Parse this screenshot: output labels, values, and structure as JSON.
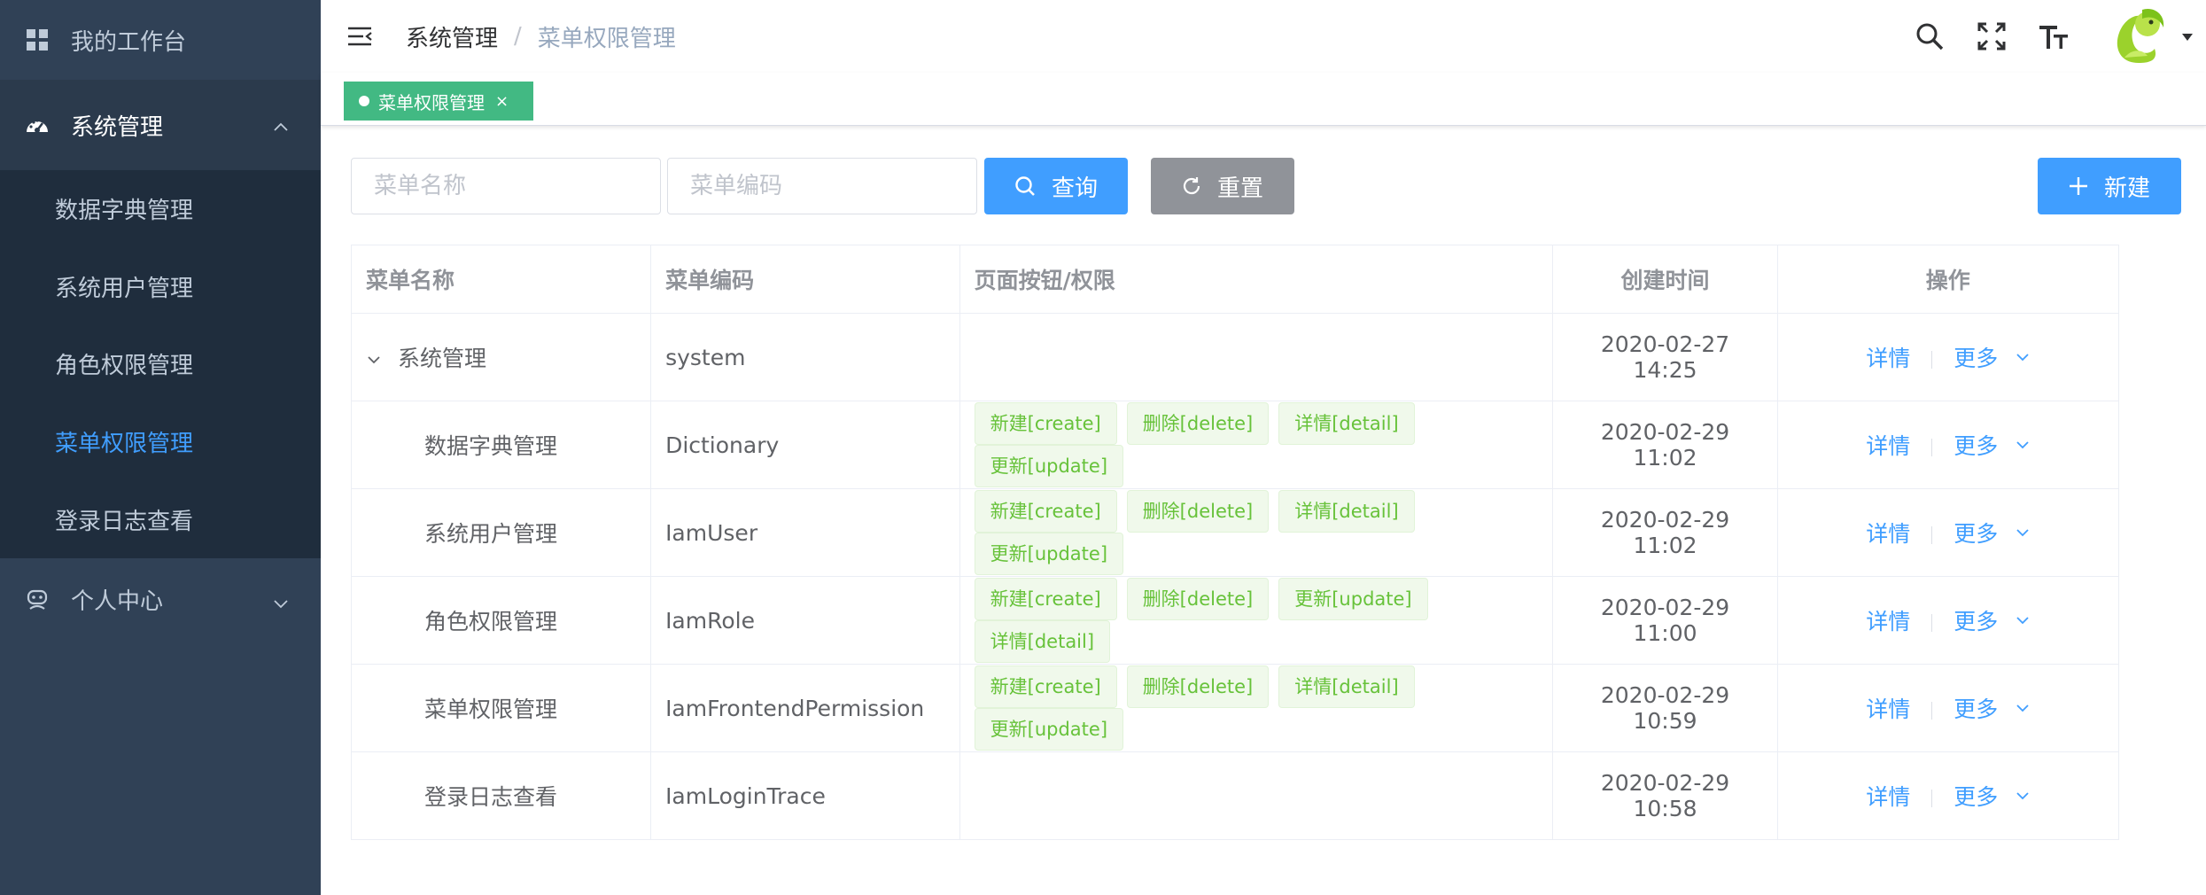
{
  "sidebar": {
    "workbench": "我的工作台",
    "system_group": "系统管理",
    "sub_items": [
      "数据字典管理",
      "系统用户管理",
      "角色权限管理",
      "菜单权限管理",
      "登录日志查看"
    ],
    "personal_group": "个人中心"
  },
  "header": {
    "breadcrumb_parent": "系统管理",
    "breadcrumb_separator": "/",
    "breadcrumb_current": "菜单权限管理"
  },
  "tags": {
    "active_tag": "菜单权限管理",
    "close_glyph": "×"
  },
  "search": {
    "name_placeholder": "菜单名称",
    "code_placeholder": "菜单编码",
    "query_label": "查询",
    "reset_label": "重置",
    "new_label": "新建"
  },
  "table": {
    "columns": [
      "菜单名称",
      "菜单编码",
      "页面按钮/权限",
      "创建时间",
      "操作"
    ],
    "rows": [
      {
        "name": "系统管理",
        "code": "system",
        "perms": [],
        "time": "2020-02-27 14:25"
      },
      {
        "name": "数据字典管理",
        "code": "Dictionary",
        "perms": [
          "新建[create]",
          "删除[delete]",
          "详情[detail]",
          "更新[update]"
        ],
        "time": "2020-02-29 11:02"
      },
      {
        "name": "系统用户管理",
        "code": "IamUser",
        "perms": [
          "新建[create]",
          "删除[delete]",
          "详情[detail]",
          "更新[update]"
        ],
        "time": "2020-02-29 11:02"
      },
      {
        "name": "角色权限管理",
        "code": "IamRole",
        "perms": [
          "新建[create]",
          "删除[delete]",
          "更新[update]",
          "详情[detail]"
        ],
        "time": "2020-02-29 11:00"
      },
      {
        "name": "菜单权限管理",
        "code": "IamFrontendPermission",
        "perms": [
          "新建[create]",
          "删除[delete]",
          "详情[detail]",
          "更新[update]"
        ],
        "time": "2020-02-29 10:59"
      },
      {
        "name": "登录日志查看",
        "code": "IamLoginTrace",
        "perms": [],
        "time": "2020-02-29 10:58"
      }
    ],
    "detail_label": "详情",
    "more_label": "更多"
  },
  "colors": {
    "sidebar_bg": "#304156",
    "submenu_bg": "#1f2d3d",
    "primary": "#409eff",
    "tag_green": "#42b983",
    "perm_tag_text": "#67c23a"
  },
  "icons": [
    "dashboard-icon",
    "gauge-icon",
    "user-robot-icon",
    "menu-fold-icon",
    "search-icon",
    "fullscreen-icon",
    "text-size-icon",
    "search-icon",
    "refresh-icon",
    "plus-icon",
    "chevron-down-icon"
  ]
}
